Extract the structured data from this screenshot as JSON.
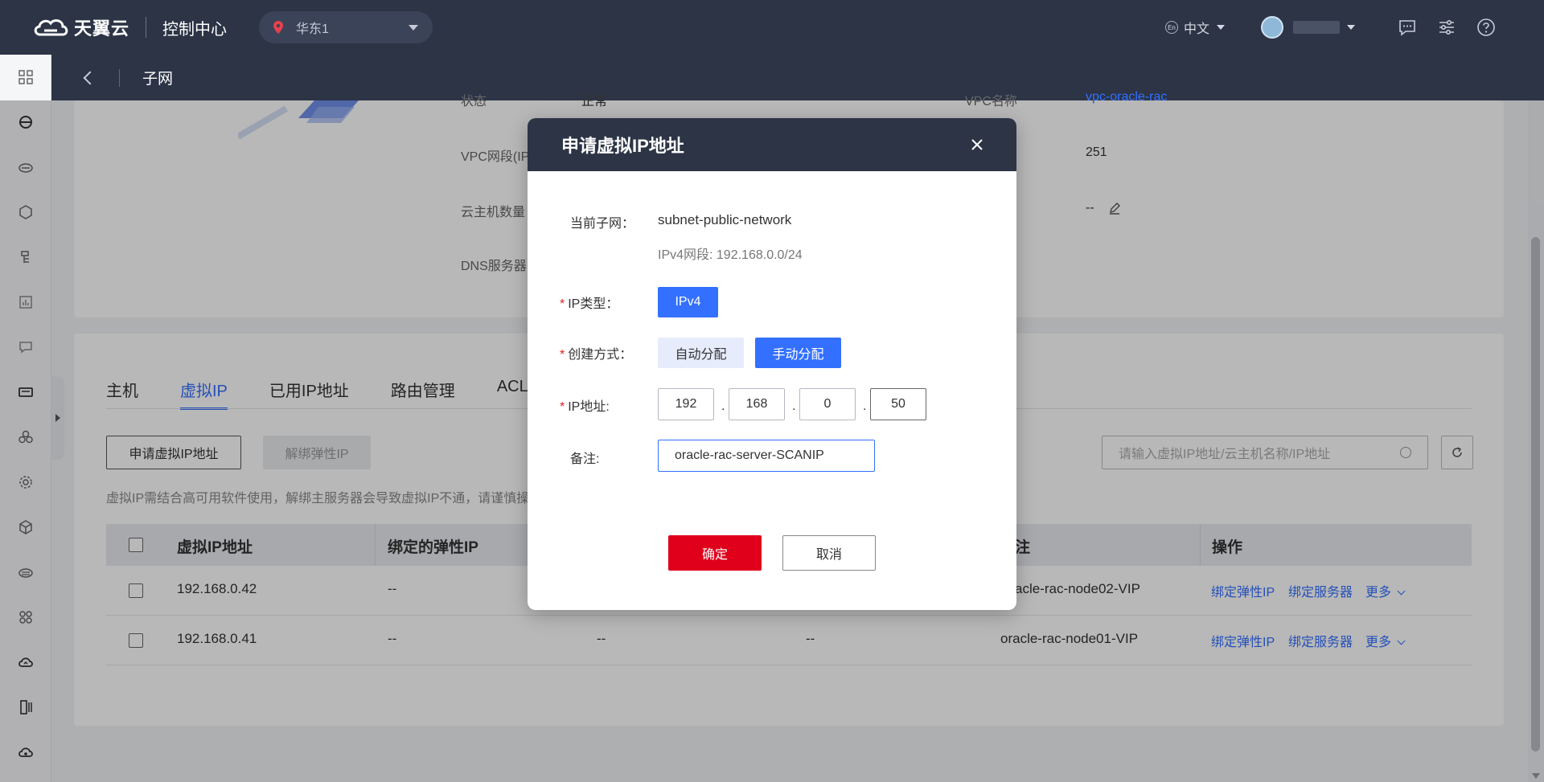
{
  "topbar": {
    "brand": "天翼云",
    "console": "控制中心",
    "region": "华东1",
    "language_icon": "En",
    "language": "中文"
  },
  "subheader": {
    "title": "子网"
  },
  "info": {
    "status_label": "状态",
    "status_value": "正常",
    "vpc_name_label": "VPC名称",
    "vpc_name_value": "vpc-oracle-rac",
    "vpc_cidr_label": "VPC网段(IP",
    "available_ip_value": "251",
    "vm_count_label": "云主机数量",
    "remark_value": "--",
    "dns_label": "DNS服务器"
  },
  "tabs": [
    {
      "label": "主机"
    },
    {
      "label": "虚拟IP"
    },
    {
      "label": "已用IP地址"
    },
    {
      "label": "路由管理"
    },
    {
      "label": "ACL"
    }
  ],
  "toolbar": {
    "apply_label": "申请虚拟IP地址",
    "unbind_label": "解绑弹性IP",
    "hint": "虚拟IP需结合高可用软件使用，解绑主服务器会导致虚拟IP不通，请谨慎操",
    "search_placeholder": "请输入虚拟IP地址/云主机名称/IP地址"
  },
  "table": {
    "headers": {
      "vip": "虚拟IP地址",
      "eip": "绑定的弹性IP",
      "remark": "注",
      "ops": "操作"
    },
    "rows": [
      {
        "vip": "192.168.0.42",
        "eip": "--",
        "col3": "",
        "col4": "",
        "remark": "acle-rac-node02-VIP",
        "op1": "绑定弹性IP",
        "op2": "绑定服务器",
        "op3": "更多"
      },
      {
        "vip": "192.168.0.41",
        "eip": "--",
        "col3": "--",
        "col4": "--",
        "remark": "oracle-rac-node01-VIP",
        "op1": "绑定弹性IP",
        "op2": "绑定服务器",
        "op3": "更多"
      }
    ]
  },
  "modal": {
    "title": "申请虚拟IP地址",
    "subnet_label": "当前子网：",
    "subnet_value": "subnet-public-network",
    "subnet_cidr": "IPv4网段: 192.168.0.0/24",
    "ip_type_label": "IP类型：",
    "ip_type_value": "IPv4",
    "create_mode_label": "创建方式：",
    "create_auto": "自动分配",
    "create_manual": "手动分配",
    "ip_label": "IP地址:",
    "ip_octets": [
      "192",
      "168",
      "0",
      "50"
    ],
    "remark_label": "备注:",
    "remark_value": "oracle-rac-server-SCANIP",
    "ok_label": "确定",
    "cancel_label": "取消",
    "required_mark": "*"
  },
  "colors": {
    "topbar_bg": "#2c3446",
    "accent": "#3370ff",
    "primary_red": "#e0001b"
  }
}
